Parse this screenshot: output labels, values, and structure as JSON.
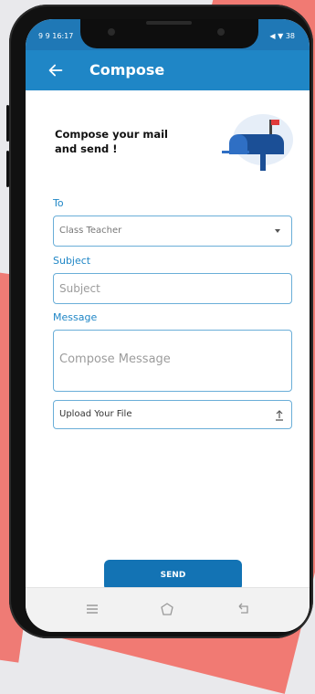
{
  "statusbar": {
    "left": "9 9 16:17",
    "right": "◀ ▼ 38"
  },
  "appbar": {
    "title": "Compose",
    "back_icon": "arrow-back-icon"
  },
  "heading": "Compose your mail and send !",
  "illustration": "mailbox-icon",
  "form": {
    "to_label": "To",
    "to_value": "Class Teacher",
    "subject_label": "Subject",
    "subject_placeholder": "Subject",
    "message_label": "Message",
    "message_placeholder": "Compose Message",
    "upload_text": "Upload Your File",
    "upload_icon": "upload-icon"
  },
  "send_label": "SEND",
  "nav": [
    "menu-icon",
    "home-icon",
    "back-icon"
  ],
  "colors": {
    "primary": "#1f86c6",
    "button": "#1373b4",
    "background": "#f17a73"
  }
}
